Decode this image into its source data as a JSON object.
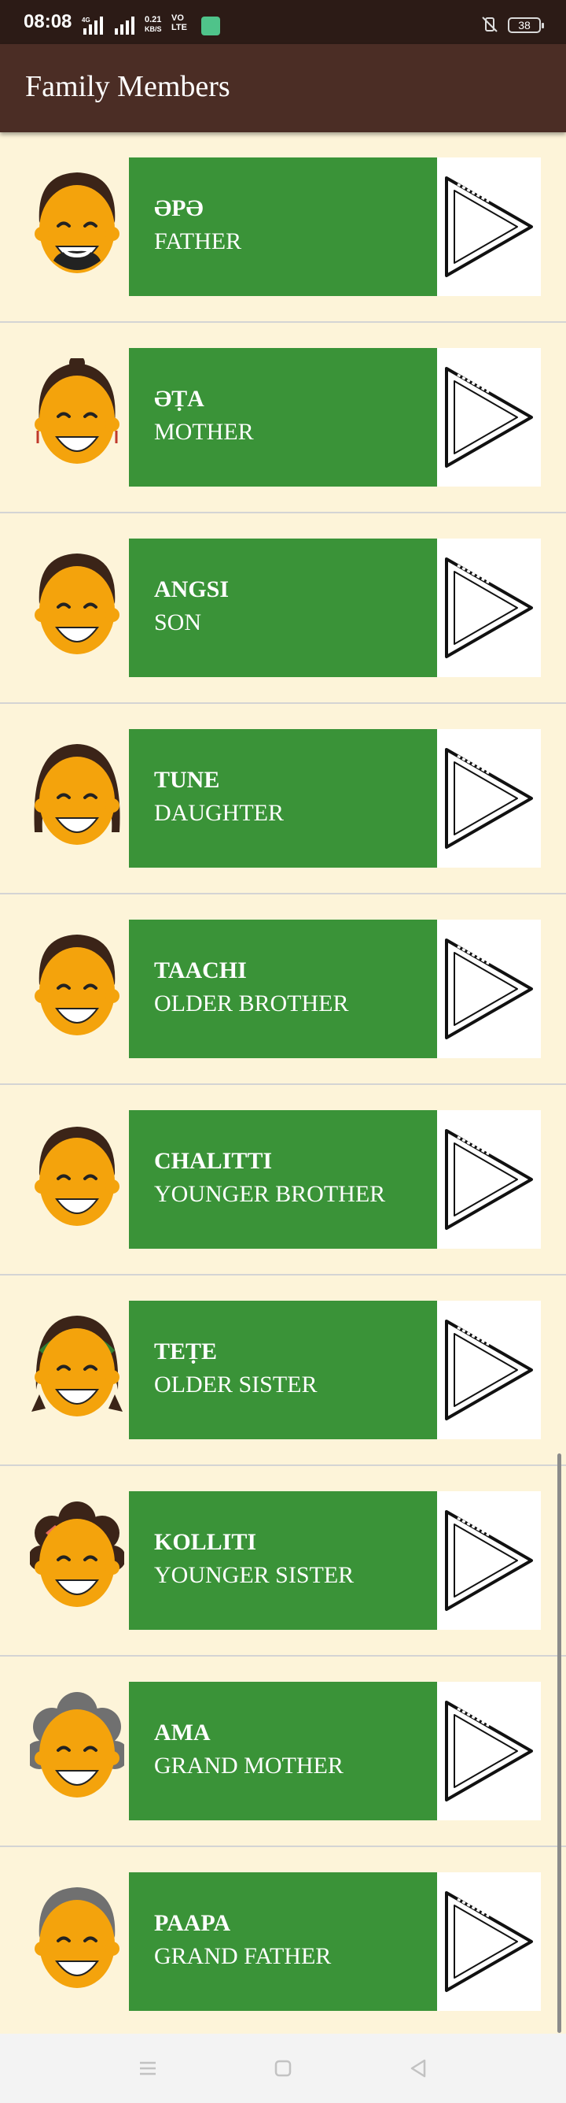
{
  "status": {
    "time": "08:08",
    "net_small": "4G",
    "speed_top": "0.21",
    "speed_bottom": "KB/S",
    "lte_top": "VO",
    "lte_bottom": "LTE",
    "battery": "38"
  },
  "app": {
    "title": "Family Members"
  },
  "members": [
    {
      "name": "ƏPƏ",
      "english": "FATHER",
      "avatar": "man-beard-avatar-icon"
    },
    {
      "name": "ƏṬA",
      "english": "MOTHER",
      "avatar": "woman-earrings-avatar-icon"
    },
    {
      "name": "ANGSI",
      "english": "SON",
      "avatar": "boy-avatar-icon"
    },
    {
      "name": "TUNE",
      "english": "DAUGHTER",
      "avatar": "girl-avatar-icon"
    },
    {
      "name": "TAACHI",
      "english": "OLDER BROTHER",
      "avatar": "young-man-avatar-icon"
    },
    {
      "name": "CHALITTI",
      "english": "YOUNGER BROTHER",
      "avatar": "young-boy-avatar-icon"
    },
    {
      "name": "TEṬE",
      "english": "OLDER SISTER",
      "avatar": "girl-headband-avatar-icon"
    },
    {
      "name": "KOLLITI",
      "english": "YOUNGER SISTER",
      "avatar": "girl-bow-avatar-icon"
    },
    {
      "name": "AMA",
      "english": "GRAND MOTHER",
      "avatar": "grandmother-avatar-icon"
    },
    {
      "name": "PAAPA",
      "english": "GRAND FATHER",
      "avatar": "grandfather-avatar-icon"
    }
  ],
  "colors": {
    "status": "#2c1b16",
    "appbar": "#4b2d25",
    "background": "#fdf4d9",
    "card": "#3a9338",
    "skin": "#f4a30c",
    "hair": "#3b2418",
    "grey_hair": "#707070"
  }
}
